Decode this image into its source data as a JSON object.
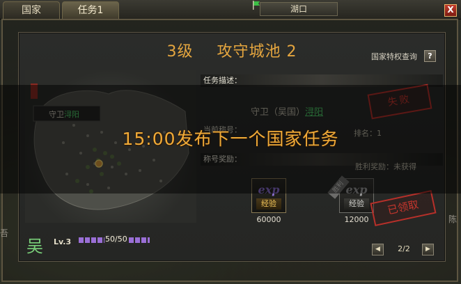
{
  "tabs": {
    "country": "国家",
    "task": "任务1"
  },
  "location": {
    "name": "湖口",
    "flag_color": "#3cbf45"
  },
  "close_label": "X",
  "panel": {
    "title_level": "3级",
    "title_name": "攻守城池 2",
    "privilege_link": "国家特权查询",
    "help_label": "?"
  },
  "map": {
    "guard_label": "守卫",
    "guard_location": "浔阳"
  },
  "task": {
    "description_header": "任务描述：",
    "guard_text": "守卫（吴国）",
    "guard_location": "浔阳",
    "current_title_label": "当前称号：",
    "rank_label": "排名：1",
    "title_reward_header": "称号奖励：",
    "victory_reward": "胜利奖励：未获得"
  },
  "stamps": {
    "failed": "失败",
    "claimed": "已领取"
  },
  "rewards": [
    {
      "icon": "exp",
      "label": "经验",
      "value": "60000"
    },
    {
      "icon": "exp",
      "label": "经验",
      "value": "12000",
      "tag": "胜利"
    }
  ],
  "announcement": "15:00发布下一个国家任务",
  "player": {
    "faction": "吴",
    "level": "Lv.3",
    "xp": "50/50",
    "xp_fraction": 1.0
  },
  "pager": {
    "indicator": "2/2",
    "prev": "◀",
    "next": "▶"
  },
  "edges": {
    "right": "陈",
    "left": "吾"
  },
  "colors": {
    "title": "#e5a63f",
    "announcement": "#f0ab38",
    "stamp": "#c7362d",
    "link_green": "#4fd06a",
    "xp_bar": "#9a6fd6"
  }
}
